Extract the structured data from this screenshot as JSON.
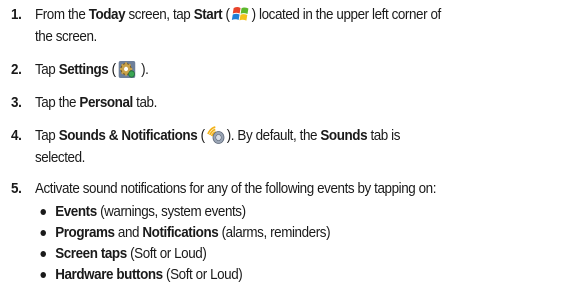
{
  "steps": [
    {
      "num": "1.",
      "p1": "From the ",
      "b1": "Today",
      "p2": " screen, tap ",
      "b2": "Start",
      "p3": " (",
      "p4": ") located in the upper left corner of",
      "line2": "the screen.",
      "icon": "windows-start-icon"
    },
    {
      "num": "2.",
      "p1": "Tap ",
      "b1": "Settings",
      "p2": " (",
      "p3": " ).",
      "icon": "settings-gear-icon"
    },
    {
      "num": "3.",
      "p1": "Tap the ",
      "b1": "Personal",
      "p2": " tab."
    },
    {
      "num": "4.",
      "p1": "Tap ",
      "b1": "Sounds & Notifications",
      "p2": " (",
      "p3": "). By default, the ",
      "b2": "Sounds",
      "p4": " tab is",
      "line2": "selected.",
      "icon": "sounds-speaker-icon"
    },
    {
      "num": "5.",
      "text": "Activate sound notifications for any of the following events by tapping on:",
      "bullets": [
        {
          "b1": "Events",
          "p1": " (warnings, system events)"
        },
        {
          "b1": "Programs",
          "p1": " and ",
          "b2": "Notifications",
          "p2": " (alarms, reminders)"
        },
        {
          "b1": "Screen taps",
          "p1": " (Soft or Loud)"
        },
        {
          "b1": "Hardware buttons",
          "p1": " (Soft or Loud)"
        }
      ]
    }
  ]
}
